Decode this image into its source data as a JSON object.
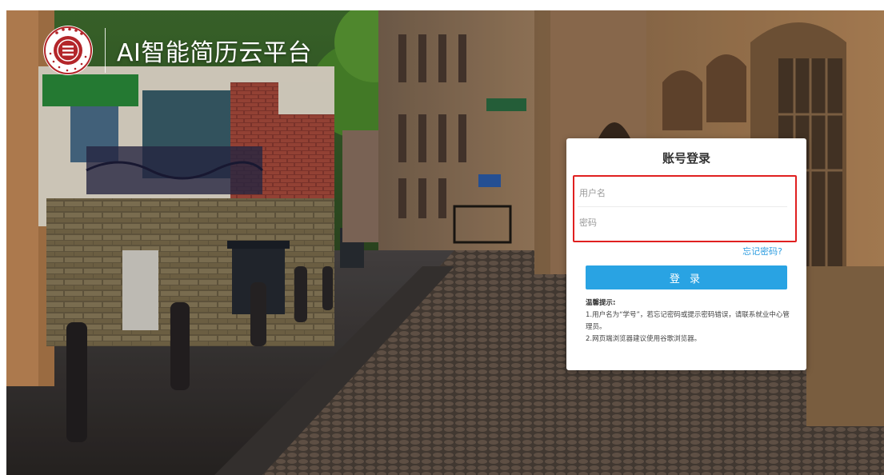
{
  "brand": {
    "title": "AI智能简历云平台",
    "logo_icon": "university-seal-icon"
  },
  "login": {
    "title": "账号登录",
    "username_placeholder": "用户名",
    "password_placeholder": "密码",
    "forgot_label": "忘记密码?",
    "submit_label": "登 录",
    "tips_heading": "温馨提示:",
    "tips": [
      "1.用户名为“学号”，若忘记密码或提示密码错误，请联系就业中心管理员。",
      "2.网页端浏览器建议使用谷歌浏览器。"
    ]
  },
  "colors": {
    "accent": "#29a3e3",
    "highlight_border": "#e02020",
    "link": "#2e9de0",
    "seal": "#b3262a"
  }
}
